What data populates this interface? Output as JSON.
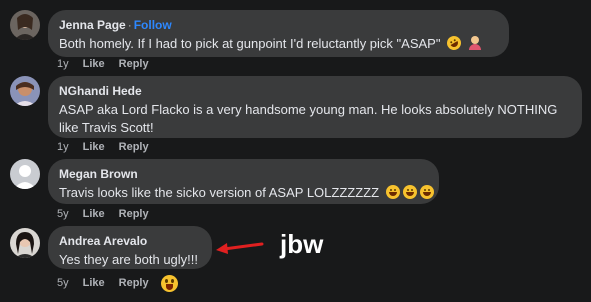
{
  "colors": {
    "background": "#18191a",
    "bubble": "#3a3b3c",
    "follow_link": "#2d88ff",
    "annotation_arrow": "#e02020"
  },
  "comments": [
    {
      "author": "Jenna Page",
      "separator": "·",
      "follow_label": "Follow",
      "text": "Both homely. If I had to pick at gunpoint I'd reluctantly pick \"ASAP\"",
      "emojis": [
        "rofl-emoji",
        "person-shrugging-emoji"
      ],
      "age": "1y",
      "like_label": "Like",
      "reply_label": "Reply"
    },
    {
      "author": "NGhandi Hede",
      "text_line1": "ASAP aka Lord Flacko is a very handsome young man. He looks absolutely NOTHING",
      "text_line2": "like Travis Scott!",
      "age": "1y",
      "like_label": "Like",
      "reply_label": "Reply"
    },
    {
      "author": "Megan Brown",
      "text": "Travis looks like the sicko version of ASAP LOLZZZZZZ",
      "emojis": [
        "joy-emoji",
        "joy-emoji",
        "joy-emoji"
      ],
      "age": "5y",
      "like_label": "Like",
      "reply_label": "Reply"
    },
    {
      "author": "Andrea Arevalo",
      "text": "Yes they are both ugly!!!",
      "age": "5y",
      "like_label": "Like",
      "reply_label": "Reply",
      "reaction_icon": "grinning-emoji"
    }
  ],
  "annotation": {
    "label": "jbw",
    "arrow_icon": "red-arrow-icon"
  }
}
